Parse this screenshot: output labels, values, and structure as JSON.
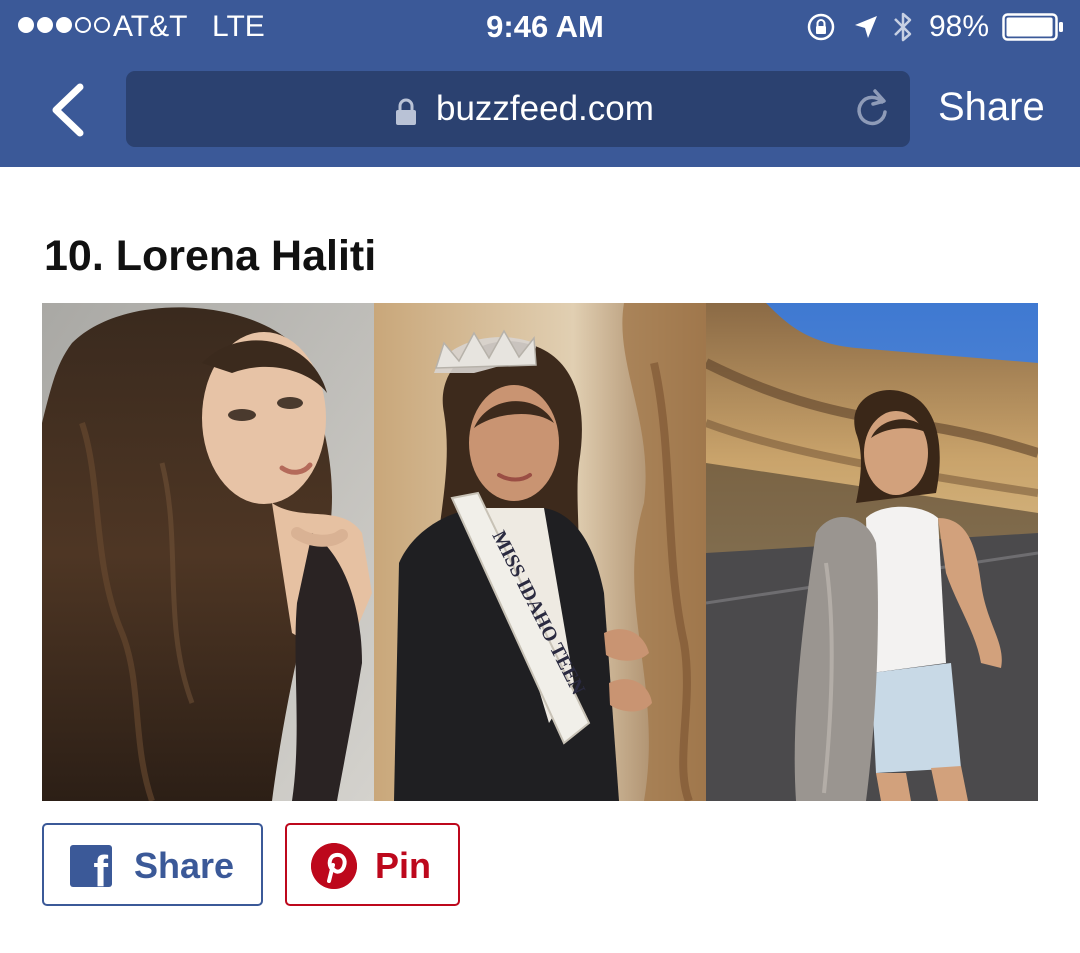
{
  "status_bar": {
    "carrier": "AT&T",
    "network": "LTE",
    "time": "9:46 AM",
    "battery": "98%",
    "battery_level": 0.98,
    "signal_bars_filled": 3,
    "signal_bars_total": 5
  },
  "nav": {
    "url": "buzzfeed.com",
    "share_label": "Share"
  },
  "article": {
    "heading": "10. Lorena Haliti",
    "sash_text": "MISS IDAHO TEEN"
  },
  "share_buttons": {
    "facebook_label": "Share",
    "pinterest_label": "Pin"
  },
  "colors": {
    "facebook_blue": "#3b5998",
    "url_box": "#2b4170",
    "pinterest_red": "#bd081c"
  },
  "icons": [
    "back-chevron-icon",
    "padlock-icon",
    "reload-icon",
    "rotation-lock-icon",
    "location-arrow-icon",
    "bluetooth-icon",
    "battery-icon",
    "facebook-icon",
    "pinterest-icon"
  ]
}
